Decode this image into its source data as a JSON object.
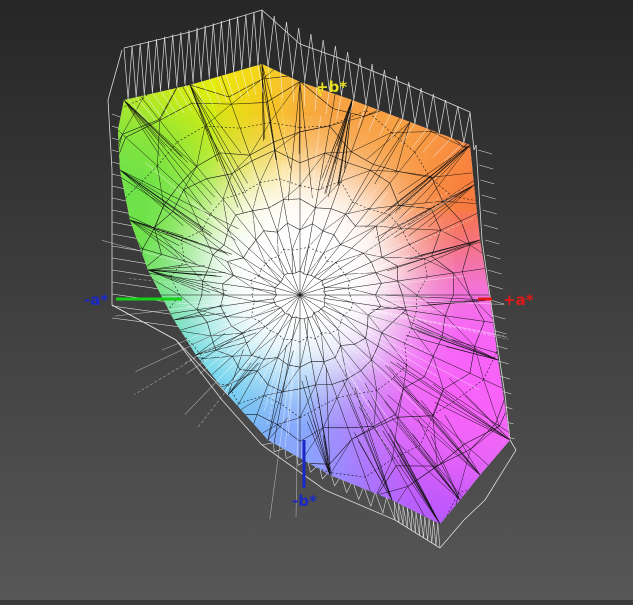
{
  "view": {
    "background_top": "#262626",
    "background_bottom": "#575757"
  },
  "axes": {
    "a_negative": {
      "label": "-a*",
      "color": "#18d018",
      "label_color": "#1a28c8"
    },
    "a_positive": {
      "label": "+a*",
      "color": "#e01818",
      "label_color": "#e01818"
    },
    "b_negative": {
      "label": "-b*",
      "color": "#1a28c8",
      "label_color": "#1a28c8"
    },
    "b_positive": {
      "label": "+b*",
      "color": "#e8e020",
      "label_color": "#e8e020"
    }
  },
  "gamut_colors": {
    "yellow": "#f8ef00",
    "green": "#6ae24a",
    "cyan": "#54d8e8",
    "blue": "#8aa0ff",
    "violet": "#a048ff",
    "magenta": "#f860f8",
    "red": "#f86a3a",
    "orange": "#f8a040",
    "white": "#ffffff"
  },
  "mesh": {
    "solid_color": "#101010",
    "reference_color": "#dcdcdc"
  }
}
